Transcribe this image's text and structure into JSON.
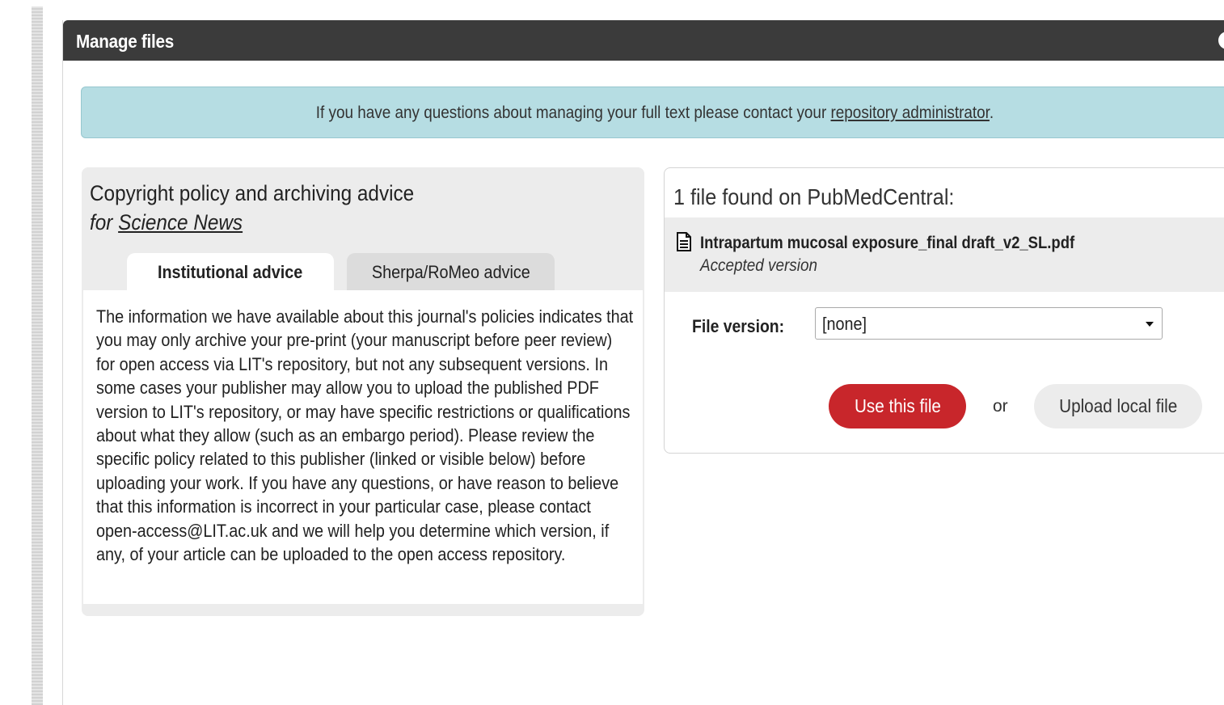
{
  "dialog": {
    "title": "Manage files",
    "info_icon": "info-icon"
  },
  "alert": {
    "text_before": "If you have any questions about managing your full text please contact your ",
    "link_text": "repository administrator",
    "text_after": "."
  },
  "policy": {
    "title": "Copyright policy and archiving advice",
    "subtitle_prefix": "for ",
    "journal": "Science News",
    "tabs": [
      {
        "label": "Institutional advice",
        "active": true
      },
      {
        "label": "Sherpa/RoMeo advice",
        "active": false
      }
    ],
    "body": "The information we have available about this journal's policies indicates that you may only archive your pre-print (your manuscript before peer review) for open access via LIT's repository, but not any subsequent versions. In some cases your publisher may allow you to upload the published PDF version to LIT's repository, or may have specific restrictions or qualifications about what they allow (such as an embargo period). Please review the specific policy related to this publisher (linked or visible below) before uploading your work. If you have any questions, or have reason to believe that this information is incorrect in your particular case, please contact open-access@LIT.ac.uk and we will help you determine which version, if any, of your article can be uploaded to the open access repository."
  },
  "files": {
    "heading": "1 file found on PubMedCentral:",
    "file": {
      "icon": "document-icon",
      "name": "Intrapartum mucosal exposure_final draft_v2_SL.pdf",
      "version": "Accepted version"
    },
    "version_field": {
      "label": "File version:",
      "value": "[none]"
    },
    "use_button": "Use this file",
    "or_text": "or",
    "upload_button": "Upload local file"
  },
  "colors": {
    "header_bg": "#3b3b3b",
    "alert_bg": "#b6dde3",
    "primary_button": "#c8262b",
    "panel_bg": "#ececec"
  }
}
